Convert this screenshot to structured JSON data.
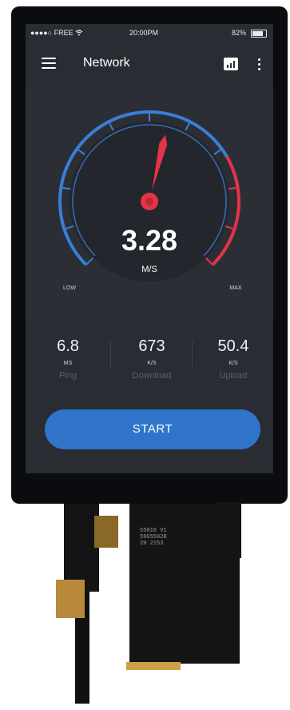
{
  "statusbar": {
    "carrier": "●●●●○ FREE",
    "time": "20:00PM",
    "battery": "82%",
    "battery_level": 0.82
  },
  "appbar": {
    "title": "Network"
  },
  "gauge": {
    "value": "3.28",
    "unit": "M/S",
    "low_label": "LOW",
    "max_label": "MAX",
    "level": 0.55
  },
  "stats": [
    {
      "value": "6.8",
      "unit": "MS",
      "label": "Ping"
    },
    {
      "value": "673",
      "unit": "K/S",
      "label": "Download"
    },
    {
      "value": "50.4",
      "unit": "K/S",
      "label": "Upload"
    }
  ],
  "start_label": "START",
  "colors": {
    "background": "#2a2c34",
    "accent_blue": "#3a7fd6",
    "accent_red": "#e63347",
    "button": "#2f74c9"
  },
  "icons": [
    "wifi-icon",
    "battery-icon",
    "menu-icon",
    "chart-icon",
    "more-icon"
  ],
  "pcb_text": {
    "line1": "55018  V1",
    "line2": "5905502B",
    "line3": "2H 2153"
  }
}
